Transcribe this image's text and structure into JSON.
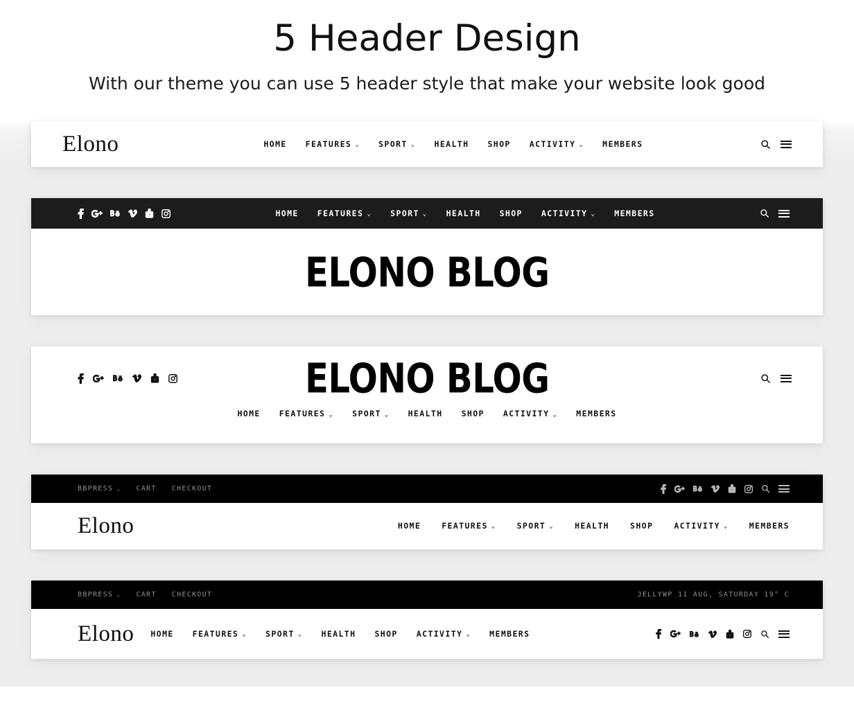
{
  "page": {
    "title": "5 Header Design",
    "subtitle": "With our theme you can use 5 header style that make your website look good"
  },
  "brand": {
    "serif_logo": "Elono",
    "block_logo": "ELONO BLOG",
    "accent_color": "#000000",
    "bar_dark_color": "#1c1c1c",
    "bar_black_color": "#000000",
    "page_bg_color": "#ededed",
    "muted_text_color": "#8e8e8e"
  },
  "nav": {
    "items": [
      {
        "label": "HOME",
        "caret": ""
      },
      {
        "label": "FEATURES",
        "caret": "⌄"
      },
      {
        "label": "SPORT",
        "caret": "⌄"
      },
      {
        "label": "HEALTH",
        "caret": ""
      },
      {
        "label": "SHOP",
        "caret": ""
      },
      {
        "label": "ACTIVITY",
        "caret": "⌄"
      },
      {
        "label": "MEMBERS",
        "caret": ""
      }
    ]
  },
  "social": {
    "items": [
      {
        "name": "facebook-icon",
        "label": "f"
      },
      {
        "name": "googleplus-icon",
        "label": "G+"
      },
      {
        "name": "behance-icon",
        "label": "Bē"
      },
      {
        "name": "vimeo-icon",
        "label": "V"
      },
      {
        "name": "youtube-icon",
        "label": "YouTube"
      },
      {
        "name": "instagram-icon",
        "label": "Instagram"
      }
    ]
  },
  "actions": {
    "search_label": "Search",
    "menu_label": "Menu"
  },
  "topbar": {
    "links": [
      {
        "label": "BBPRESS",
        "caret": "⌄"
      },
      {
        "label": "CART",
        "caret": ""
      },
      {
        "label": "CHECKOUT",
        "caret": ""
      }
    ],
    "weather_note": "JELLYWP 11 AUG, SATURDAY 19° C"
  },
  "headers": [
    {
      "id": "header-1",
      "style": "logo-left-nav-center-light"
    },
    {
      "id": "header-2",
      "style": "dark-bar-social-left-logo-below"
    },
    {
      "id": "header-3",
      "style": "social-left-logo-center-nav-below"
    },
    {
      "id": "header-4",
      "style": "black-topbar-logo-left-nav-right"
    },
    {
      "id": "header-5",
      "style": "black-topbar-weather-logo-nav-left"
    }
  ]
}
